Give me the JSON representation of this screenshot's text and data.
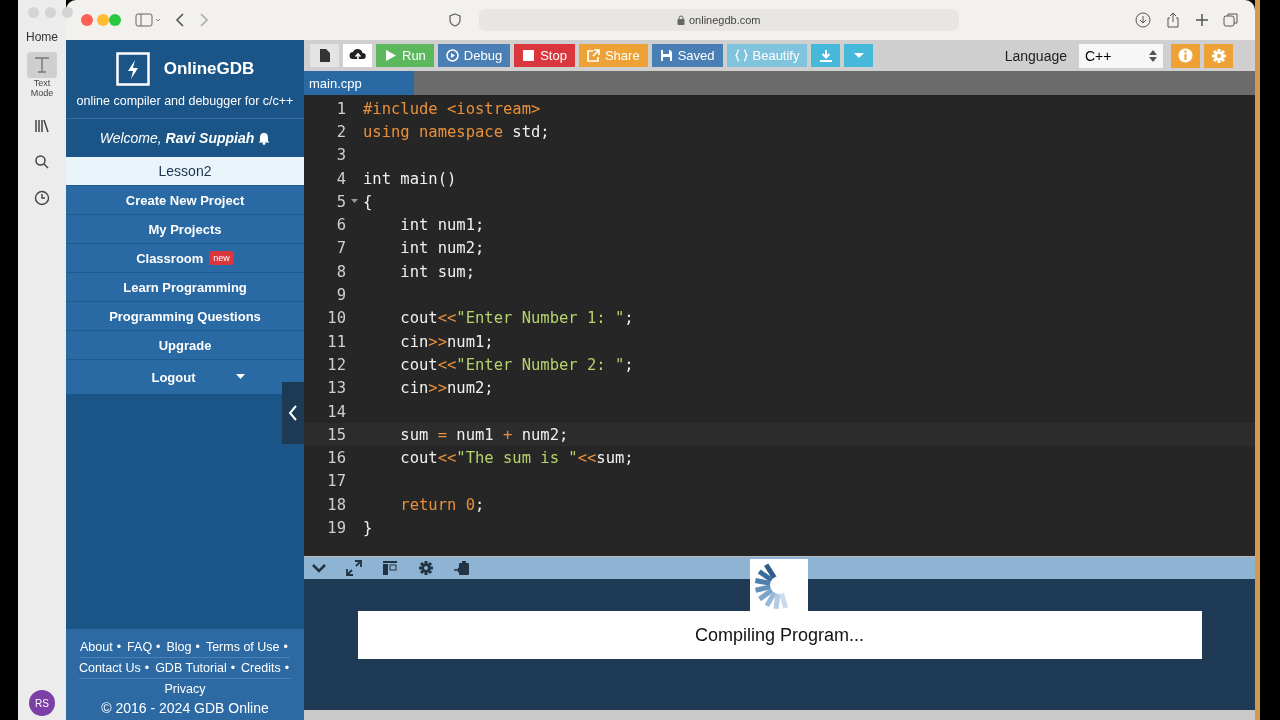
{
  "background_app": {
    "home": "Home",
    "tool_label": "Text\nMode",
    "avatar": "RS"
  },
  "browser": {
    "url": "onlinegdb.com"
  },
  "sidebar": {
    "brand": "OnlineGDB",
    "tagline": "online compiler and debugger for c/c++",
    "welcome": "Welcome,",
    "user": "Ravi Suppiah",
    "items": [
      {
        "label": "Lesson2",
        "selected": true
      },
      {
        "label": "Create New Project",
        "selected": false
      },
      {
        "label": "My Projects",
        "selected": false
      },
      {
        "label": "Classroom",
        "badge": "new",
        "selected": false
      },
      {
        "label": "Learn Programming",
        "selected": false
      },
      {
        "label": "Programming Questions",
        "selected": false
      },
      {
        "label": "Upgrade",
        "selected": false
      }
    ],
    "logout": "Logout",
    "footer_lines": [
      [
        {
          "label": "About",
          "sep": "•"
        },
        {
          "label": "FAQ",
          "sep": "•"
        },
        {
          "label": "Blog",
          "sep": "•"
        },
        {
          "label": "Terms of Use",
          "sep": "•"
        }
      ],
      [
        {
          "label": "Contact Us",
          "sep": "•"
        },
        {
          "label": "GDB Tutorial",
          "sep": "•"
        },
        {
          "label": "Credits",
          "sep": "•"
        }
      ],
      [
        {
          "label": "Privacy"
        }
      ]
    ],
    "copyright": "© 2016 - 2024 GDB Online"
  },
  "toolbar": {
    "buttons": [
      {
        "kind": "file",
        "selected": false
      },
      {
        "kind": "upload",
        "selected": true
      },
      {
        "kind": "run",
        "label": "Run",
        "color": "#5cb85c"
      },
      {
        "kind": "debug",
        "label": "Debug",
        "color": "#4a7fb5"
      },
      {
        "kind": "stop",
        "label": "Stop",
        "color": "#d9363e"
      },
      {
        "kind": "share",
        "label": "Share",
        "color": "#eea236"
      },
      {
        "kind": "save",
        "label": "Saved",
        "color": "#4a7fb5"
      },
      {
        "kind": "beautify",
        "label": "Beautify",
        "color": "#7fc4dc"
      },
      {
        "kind": "download",
        "color": "#46b8da"
      },
      {
        "kind": "dropdown",
        "color": "#46b8da"
      }
    ],
    "language_label": "Language",
    "language": "C++"
  },
  "tabs": [
    {
      "label": "main.cpp",
      "selected": true
    }
  ],
  "code": [
    {
      "n": "1",
      "tokens": [
        {
          "t": "#include <iostream>",
          "kind": "keyword"
        }
      ]
    },
    {
      "n": "2",
      "tokens": [
        {
          "t": "using namespace",
          "kind": "keyword"
        },
        {
          "t": " std;",
          "kind": "plain"
        }
      ]
    },
    {
      "n": "3"
    },
    {
      "n": "4",
      "tokens": [
        {
          "t": "int main()",
          "kind": "plain"
        }
      ]
    },
    {
      "n": "5",
      "fold": true,
      "tokens": [
        {
          "t": "{",
          "kind": "plain"
        }
      ]
    },
    {
      "n": "6",
      "tokens": [
        {
          "t": "    int num1;",
          "kind": "plain"
        }
      ]
    },
    {
      "n": "7",
      "tokens": [
        {
          "t": "    int num2;",
          "kind": "plain"
        }
      ]
    },
    {
      "n": "8",
      "tokens": [
        {
          "t": "    int sum;",
          "kind": "plain"
        }
      ]
    },
    {
      "n": "9"
    },
    {
      "n": "10",
      "tokens": [
        {
          "t": "    cout",
          "kind": "plain"
        },
        {
          "t": "<<",
          "kind": "operator"
        },
        {
          "t": "\"Enter Number 1: \"",
          "kind": "string"
        },
        {
          "t": ";",
          "kind": "plain"
        }
      ]
    },
    {
      "n": "11",
      "tokens": [
        {
          "t": "    cin",
          "kind": "plain"
        },
        {
          "t": ">>",
          "kind": "operator"
        },
        {
          "t": "num1;",
          "kind": "plain"
        }
      ]
    },
    {
      "n": "12",
      "tokens": [
        {
          "t": "    cout",
          "kind": "plain"
        },
        {
          "t": "<<",
          "kind": "operator"
        },
        {
          "t": "\"Enter Number 2: \"",
          "kind": "string"
        },
        {
          "t": ";",
          "kind": "plain"
        }
      ]
    },
    {
      "n": "13",
      "tokens": [
        {
          "t": "    cin",
          "kind": "plain"
        },
        {
          "t": ">>",
          "kind": "operator"
        },
        {
          "t": "num2;",
          "kind": "plain"
        }
      ]
    },
    {
      "n": "14"
    },
    {
      "n": "15",
      "current": true,
      "tokens": [
        {
          "t": "    sum ",
          "kind": "plain"
        },
        {
          "t": "=",
          "kind": "operator"
        },
        {
          "t": " num1 ",
          "kind": "plain"
        },
        {
          "t": "+",
          "kind": "operator"
        },
        {
          "t": " num2;",
          "kind": "plain"
        }
      ]
    },
    {
      "n": "16",
      "tokens": [
        {
          "t": "    cout",
          "kind": "plain"
        },
        {
          "t": "<<",
          "kind": "operator"
        },
        {
          "t": "\"The sum is \"",
          "kind": "string"
        },
        {
          "t": "<<",
          "kind": "operator"
        },
        {
          "t": "sum;",
          "kind": "plain"
        }
      ]
    },
    {
      "n": "17"
    },
    {
      "n": "18",
      "tokens": [
        {
          "t": "    return ",
          "kind": "keyword"
        },
        {
          "t": "0",
          "kind": "number"
        },
        {
          "t": ";",
          "kind": "plain"
        }
      ]
    },
    {
      "n": "19",
      "tokens": [
        {
          "t": "}",
          "kind": "plain"
        }
      ]
    }
  ],
  "output": {
    "message": "Compiling Program..."
  }
}
